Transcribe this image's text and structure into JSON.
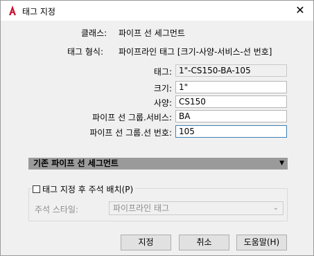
{
  "window": {
    "title": "태그 지정",
    "close_symbol": "✕"
  },
  "info": {
    "class_label": "클래스:",
    "class_value": "파이프 선 세그먼트",
    "format_label": "태그 형식:",
    "format_value": "파이프라인 태그 [크기-사양-서비스-선 번호]"
  },
  "fields": {
    "tag_label": "태그:",
    "tag_value": "1\"-CS150-BA-105",
    "size_label": "크기:",
    "size_value": "1\"",
    "spec_label": "사양:",
    "spec_value": "CS150",
    "service_label": "파이프 선 그룹.서비스:",
    "service_value": "BA",
    "line_label": "파이프 선 그룹.선 번호:",
    "line_value": "105"
  },
  "section": {
    "label": "기존 파이프 선 세그먼트",
    "arrow": "▼"
  },
  "annotation": {
    "checkbox_label": "태그 지정 후 주석 배치(P)",
    "checked": false,
    "style_label": "주석 스타일:",
    "style_value": "파이프라인 태그"
  },
  "buttons": {
    "assign": "지정",
    "cancel": "취소",
    "help": "도움말(H)"
  },
  "colors": {
    "accent": "#c8102e",
    "section_bg": "#9a9a9a",
    "focus_border": "#3c7fb1"
  }
}
